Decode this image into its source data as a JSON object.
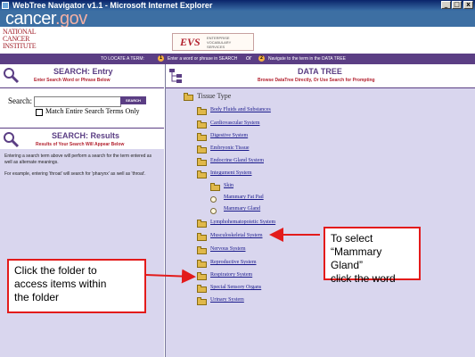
{
  "window": {
    "title": "WebTree Navigator v1.1 - Microsoft Internet Explorer"
  },
  "cancergov": {
    "brand": "cancer",
    "brand_suffix": ".gov"
  },
  "nci": {
    "line1": "NATIONAL",
    "line2": "CANCER",
    "line3": "INSTITUTE"
  },
  "evs": {
    "mark": "EVS",
    "text": "ENTERPRISE VOCABULARY SERVICES"
  },
  "instructions": {
    "lead": "TO LOCATE A TERM:",
    "step1_num": "1",
    "step1": "Enter a word or phrase in SEARCH",
    "or": "or",
    "step2_num": "2",
    "step2": "Navigate to the term in the DATA TREE"
  },
  "search_entry": {
    "title": "SEARCH: Entry",
    "subtitle": "Enter Search Word or Phrase Below"
  },
  "search": {
    "label": "Search:",
    "placeholder": "",
    "button": "SEARCH",
    "checkbox_label": "Match Entire Search Terms Only"
  },
  "search_results": {
    "title": "SEARCH: Results",
    "subtitle": "Results of Your Search Will Appear Below",
    "para1": "Entering a search term above will perform a search for the term entered as well as alternate meanings.",
    "para2": "For example, entering 'throat' will search for 'pharynx' as well as 'throat'."
  },
  "data_tree": {
    "title": "DATA TREE",
    "subtitle": "Browse DataTree Directly, Or Use Search for Prompting",
    "root": "Tissue Type",
    "items": [
      "Body Fluids and Substances",
      "Cardiovascular System",
      "Digestive System",
      "Embryonic Tissue",
      "Endocrine Gland System",
      "Integument System",
      "Skin",
      "Mammary Fat Pad",
      "Mammary Gland",
      "Lymphohematopoietic System",
      "Musculoskeletal System",
      "Nervous System",
      "Reproductive System",
      "Respiratory System",
      "Special Sensory Organs",
      "Urinary System"
    ]
  },
  "callouts": {
    "right_line1": "To select",
    "right_line2": "“Mammary Gland”",
    "right_line3": "click the word",
    "left_line1": "Click the folder to",
    "left_line2": "access items within",
    "left_line3": "the folder"
  },
  "colors": {
    "accent": "#5b3e84",
    "annotation": "#e31b1b",
    "link": "#1a1a8c"
  }
}
